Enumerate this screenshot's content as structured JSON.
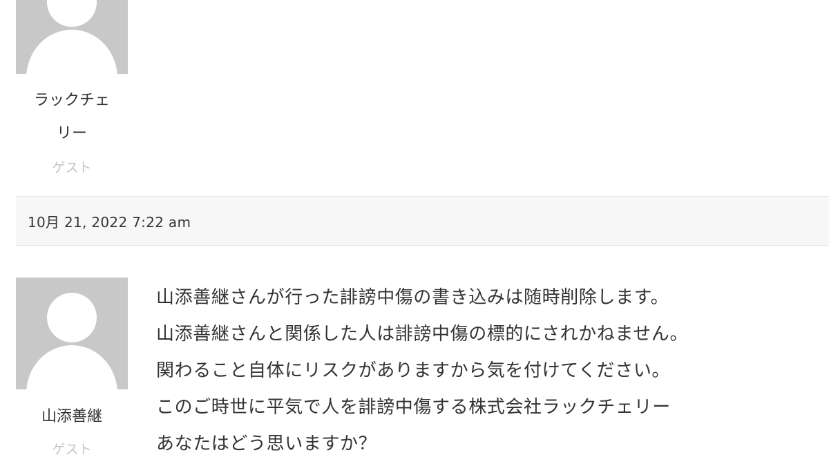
{
  "comments": [
    {
      "author": "ラックチェリー",
      "role": "ゲスト",
      "date": "10月 21, 2022 7:22 am"
    },
    {
      "author": "山添善継",
      "role": "ゲスト",
      "lines": [
        "山添善継さんが行った誹謗中傷の書き込みは随時削除します。",
        "山添善継さんと関係した人は誹謗中傷の標的にされかねません。",
        "関わること自体にリスクがありますから気を付けてください。",
        "このご時世に平気で人を誹謗中傷する株式会社ラックチェリー",
        "あなたはどう思いますか？"
      ]
    }
  ],
  "icons": {
    "avatar": "default-user-avatar-icon"
  },
  "colors": {
    "avatar_bg": "#c8c8c8",
    "avatar_figure": "#ffffff",
    "text": "#333333",
    "role_text": "#c4c4c4",
    "meta_bg": "#f7f7f7",
    "divider": "#e8e8e8"
  }
}
